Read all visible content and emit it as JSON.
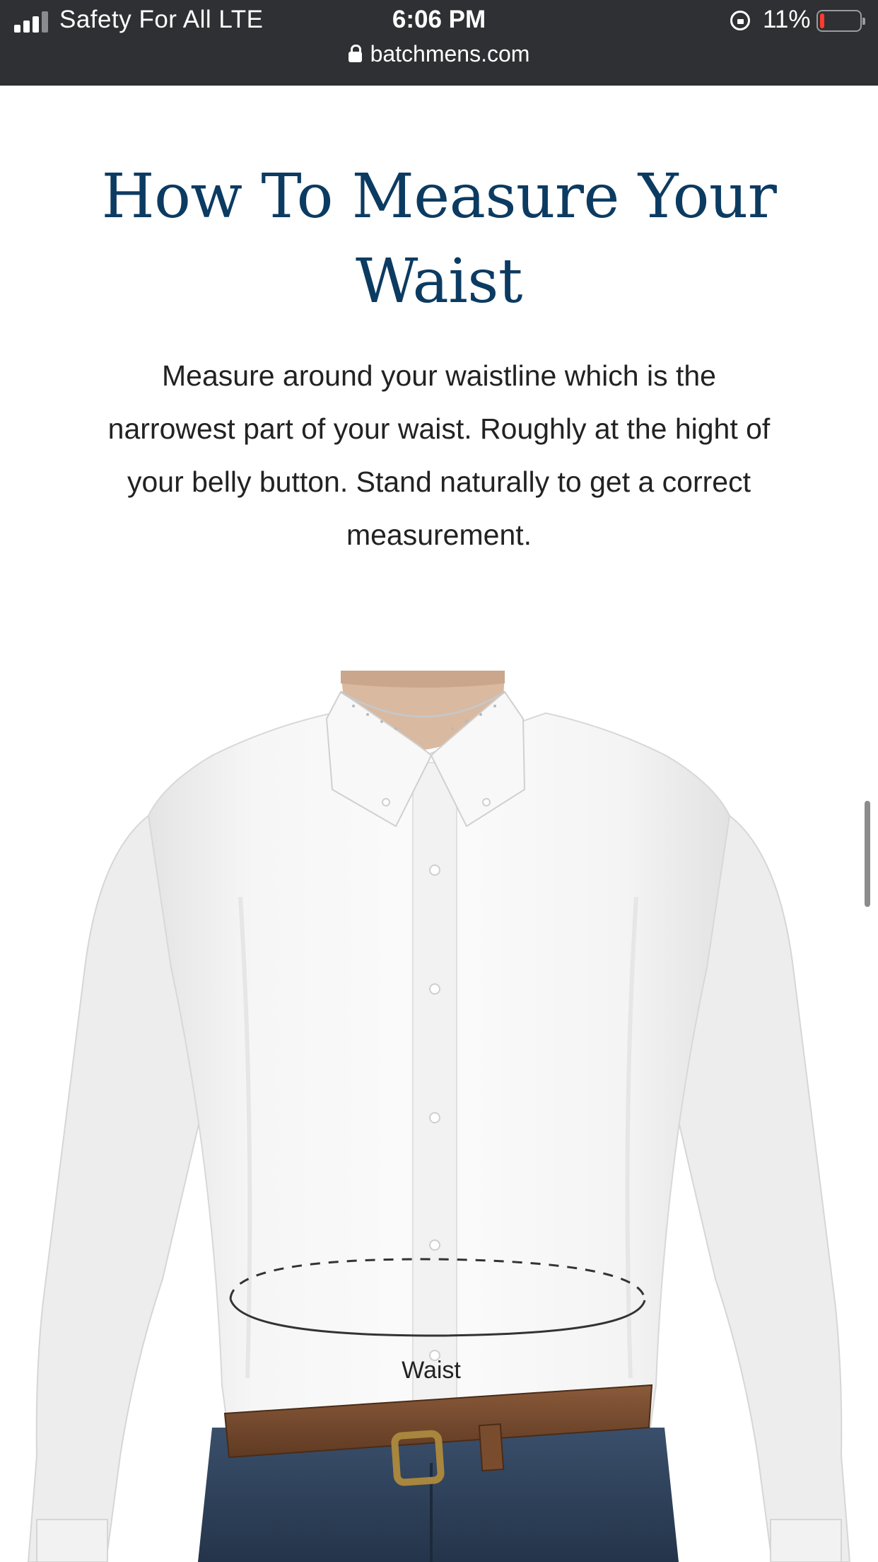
{
  "status_bar": {
    "carrier": "Safety For All  LTE",
    "time": "6:06 PM",
    "battery_percent": "11%",
    "battery_level": 0.11,
    "icons": [
      "signal-icon",
      "orientation-lock-icon",
      "battery-icon",
      "lock-icon"
    ]
  },
  "browser": {
    "url": "batchmens.com"
  },
  "article": {
    "title": "How To Measure Your Waist",
    "description": "Measure around your waistline which is the narrowest part of your waist. Roughly at the hight of your belly button. Stand naturally to get a correct measurement.",
    "image_label": "Waist"
  },
  "colors": {
    "title": "#0c3b62",
    "status_bar_bg": "#2f3033",
    "battery_low": "#ff3b30"
  }
}
